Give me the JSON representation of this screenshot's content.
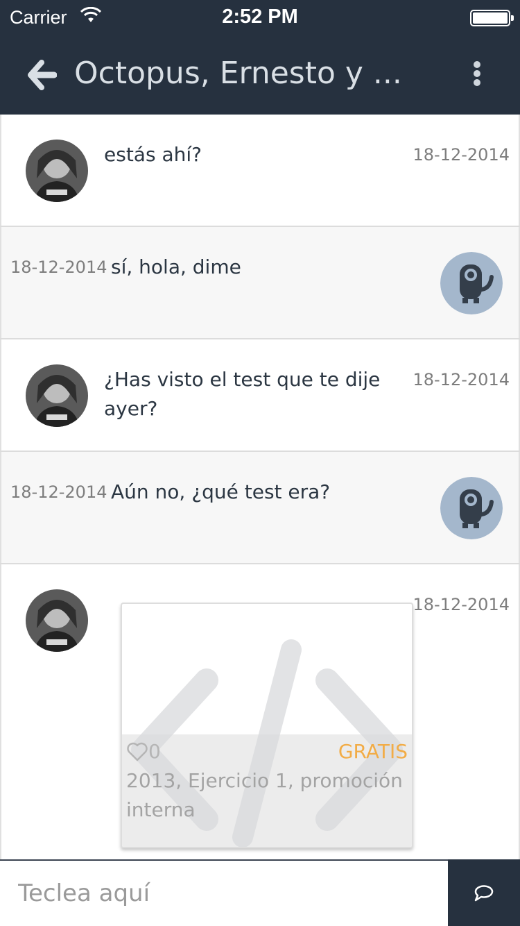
{
  "status_bar": {
    "carrier": "Carrier",
    "time": "2:52 PM"
  },
  "header": {
    "title": "Octopus, Ernesto y ...",
    "back_icon": "arrow-left-icon",
    "menu_icon": "more-vertical-icon"
  },
  "colors": {
    "header_bg": "#26313f",
    "price_accent": "#f2ac46",
    "robot_avatar_bg": "#a4b7cc"
  },
  "messages": [
    {
      "sender": "other",
      "text": "estás ahí?",
      "date": "18-12-2014"
    },
    {
      "sender": "me",
      "text": "sí, hola, dime",
      "date": "18-12-2014"
    },
    {
      "sender": "other",
      "text": "¿Has visto el test que te dije ayer?",
      "date": "18-12-2014"
    },
    {
      "sender": "me",
      "text": "Aún no, ¿qué test era?",
      "date": "18-12-2014"
    },
    {
      "sender": "other",
      "date": "18-12-2014",
      "attachment": {
        "likes": "0",
        "price": "GRATIS",
        "title": "2013, Ejercicio 1, promoción interna",
        "icon": "code-icon"
      }
    }
  ],
  "composer": {
    "placeholder": "Teclea aquí",
    "send_icon": "chat-bubble-icon"
  }
}
